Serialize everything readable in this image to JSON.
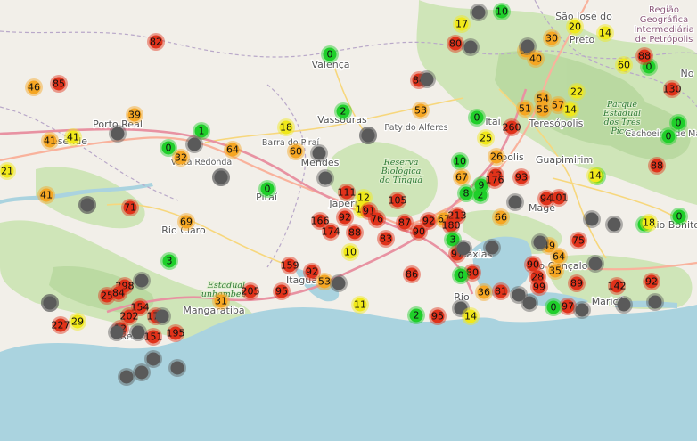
{
  "map": {
    "colors": {
      "land": "#f2efe9",
      "forest": "#cfe5b8",
      "forest_dark": "#b5d79c",
      "water": "#aad3df",
      "road_major": "#e892a2",
      "road_trunk": "#f9b29c",
      "road_minor": "#f7d77d",
      "boundary": "#b9a8c9"
    },
    "marker_colors": {
      "gray": "#5a5a5a",
      "green": "#1fcf2a",
      "yellow": "#f0e81a",
      "orange": "#f5a623",
      "red": "#e0321a"
    },
    "places": [
      {
        "id": "valenca",
        "text": "Valença"
      },
      {
        "id": "porto-real",
        "text": "Porto Real"
      },
      {
        "id": "resende",
        "text": "esende"
      },
      {
        "id": "volta-redonda",
        "text": "Volta Redonda"
      },
      {
        "id": "barra-do-pirai",
        "text": "Barra do Piraí"
      },
      {
        "id": "vassouras",
        "text": "Vassouras"
      },
      {
        "id": "paty-do-alferes",
        "text": "Paty do Alferes"
      },
      {
        "id": "mendes",
        "text": "Mendes"
      },
      {
        "id": "pirai",
        "text": "Piraí"
      },
      {
        "id": "rio-claro",
        "text": "Rio Claro"
      },
      {
        "id": "itaguai",
        "text": "Itaguaí"
      },
      {
        "id": "mangaratiba",
        "text": "Mangaratiba"
      },
      {
        "id": "angra-reis",
        "text": "Reis"
      },
      {
        "id": "japeri",
        "text": "Japeri"
      },
      {
        "id": "petropolis",
        "text": "polis"
      },
      {
        "id": "teresopolis",
        "text": "Teresópolis"
      },
      {
        "id": "guapimirim",
        "text": "Guapimirim"
      },
      {
        "id": "mage",
        "text": "Magé"
      },
      {
        "id": "caxias",
        "text": "Caxias"
      },
      {
        "id": "sao-goncalo",
        "text": "São Gonçalo"
      },
      {
        "id": "marica",
        "text": "Maricá"
      },
      {
        "id": "rio-bonito",
        "text": "Rio Bonito"
      },
      {
        "id": "cachoeiras-macacu",
        "text": "Cachoeiras de Macacu"
      },
      {
        "id": "sao-jose",
        "text": "São José do"
      },
      {
        "id": "preto",
        "text": "Preto"
      },
      {
        "id": "rio",
        "text": "Rio"
      },
      {
        "id": "itaipava",
        "text": "Itai"
      },
      {
        "id": "nova",
        "text": "No"
      }
    ],
    "regions": [
      {
        "id": "regiao",
        "lines": [
          "Região",
          "Geográfica",
          "Intermediária",
          "de Petrópolis"
        ]
      }
    ],
    "parks": [
      {
        "id": "reserva-tingua",
        "lines": [
          "Reserva",
          "Biológica",
          "do Tinguá"
        ]
      },
      {
        "id": "parque-tres-picos",
        "lines": [
          "Parque",
          "Estadual",
          "dos Três",
          "Picos"
        ]
      },
      {
        "id": "parque-cunhambebe",
        "lines": [
          "Estadual",
          "unhambebe"
        ]
      }
    ],
    "markers": [
      {
        "v": "82",
        "c": "red"
      },
      {
        "v": "0",
        "c": "green"
      },
      {
        "v": "46",
        "c": "orange"
      },
      {
        "v": "85",
        "c": "red"
      },
      {
        "v": "39",
        "c": "orange"
      },
      {
        "v": "41",
        "c": "orange"
      },
      {
        "v": "41",
        "c": "yellow"
      },
      {
        "v": "",
        "c": "gray"
      },
      {
        "v": "1",
        "c": "green"
      },
      {
        "v": "0",
        "c": "green"
      },
      {
        "v": "",
        "c": "gray"
      },
      {
        "v": "32",
        "c": "orange"
      },
      {
        "v": "64",
        "c": "orange"
      },
      {
        "v": "2",
        "c": "green"
      },
      {
        "v": "18",
        "c": "yellow"
      },
      {
        "v": "53",
        "c": "orange"
      },
      {
        "v": "",
        "c": "gray"
      },
      {
        "v": "",
        "c": "gray"
      },
      {
        "v": "60",
        "c": "orange"
      },
      {
        "v": "",
        "c": "gray"
      },
      {
        "v": "",
        "c": "gray"
      },
      {
        "v": "0",
        "c": "green"
      },
      {
        "v": "21",
        "c": "yellow"
      },
      {
        "v": "41",
        "c": "orange"
      },
      {
        "v": "",
        "c": "gray"
      },
      {
        "v": "71",
        "c": "red"
      },
      {
        "v": "69",
        "c": "orange"
      },
      {
        "v": "3",
        "c": "green"
      },
      {
        "v": "",
        "c": "gray"
      },
      {
        "v": "31",
        "c": "orange"
      },
      {
        "v": "205",
        "c": "red"
      },
      {
        "v": "95",
        "c": "red"
      },
      {
        "v": "",
        "c": "gray"
      },
      {
        "v": "298",
        "c": "red"
      },
      {
        "v": "25",
        "c": "red"
      },
      {
        "v": "84",
        "c": "red"
      },
      {
        "v": "29",
        "c": "yellow"
      },
      {
        "v": "227",
        "c": "red"
      },
      {
        "v": "154",
        "c": "red"
      },
      {
        "v": "202",
        "c": "red"
      },
      {
        "v": "178",
        "c": "red"
      },
      {
        "v": "",
        "c": "gray"
      },
      {
        "v": "12",
        "c": "red"
      },
      {
        "v": "151",
        "c": "red"
      },
      {
        "v": "195",
        "c": "red"
      },
      {
        "v": "",
        "c": "gray"
      },
      {
        "v": "",
        "c": "gray"
      },
      {
        "v": "",
        "c": "gray"
      },
      {
        "v": "",
        "c": "gray"
      },
      {
        "v": "",
        "c": "gray"
      },
      {
        "v": "",
        "c": "gray"
      },
      {
        "v": "159",
        "c": "red"
      },
      {
        "v": "92",
        "c": "red"
      },
      {
        "v": "53",
        "c": "orange"
      },
      {
        "v": "",
        "c": "gray"
      },
      {
        "v": "11",
        "c": "yellow"
      },
      {
        "v": "10",
        "c": "yellow"
      },
      {
        "v": "166",
        "c": "red"
      },
      {
        "v": "174",
        "c": "red"
      },
      {
        "v": "111",
        "c": "red"
      },
      {
        "v": "92",
        "c": "red"
      },
      {
        "v": "12",
        "c": "yellow"
      },
      {
        "v": "10",
        "c": "yellow"
      },
      {
        "v": "88",
        "c": "red"
      },
      {
        "v": "91",
        "c": "red"
      },
      {
        "v": "105",
        "c": "red"
      },
      {
        "v": "76",
        "c": "red"
      },
      {
        "v": "83",
        "c": "red"
      },
      {
        "v": "87",
        "c": "red"
      },
      {
        "v": "92",
        "c": "red"
      },
      {
        "v": "67",
        "c": "orange"
      },
      {
        "v": "213",
        "c": "red"
      },
      {
        "v": "180",
        "c": "red"
      },
      {
        "v": "90",
        "c": "red"
      },
      {
        "v": "3",
        "c": "green"
      },
      {
        "v": "97",
        "c": "red"
      },
      {
        "v": "86",
        "c": "red"
      },
      {
        "v": "80",
        "c": "red"
      },
      {
        "v": "0",
        "c": "green"
      },
      {
        "v": "36",
        "c": "orange"
      },
      {
        "v": "81",
        "c": "red"
      },
      {
        "v": "95",
        "c": "red"
      },
      {
        "v": "2",
        "c": "green"
      },
      {
        "v": "",
        "c": "gray"
      },
      {
        "v": "14",
        "c": "yellow"
      },
      {
        "v": "17",
        "c": "yellow"
      },
      {
        "v": "",
        "c": "gray"
      },
      {
        "v": "10",
        "c": "green"
      },
      {
        "v": "80",
        "c": "red"
      },
      {
        "v": "",
        "c": "gray"
      },
      {
        "v": "84",
        "c": "red"
      },
      {
        "v": "0",
        "c": "green"
      },
      {
        "v": "25",
        "c": "yellow"
      },
      {
        "v": "10",
        "c": "green"
      },
      {
        "v": "67",
        "c": "orange"
      },
      {
        "v": "8",
        "c": "green"
      },
      {
        "v": "2",
        "c": "green"
      },
      {
        "v": "9",
        "c": "green"
      },
      {
        "v": "13",
        "c": "red"
      },
      {
        "v": "176",
        "c": "red"
      },
      {
        "v": "93",
        "c": "red"
      },
      {
        "v": "94",
        "c": "red"
      },
      {
        "v": "101",
        "c": "red"
      },
      {
        "v": "",
        "c": "gray"
      },
      {
        "v": "66",
        "c": "orange"
      },
      {
        "v": "260",
        "c": "red"
      },
      {
        "v": "26",
        "c": "orange"
      },
      {
        "v": "51",
        "c": "orange"
      },
      {
        "v": "54",
        "c": "orange"
      },
      {
        "v": "55",
        "c": "orange"
      },
      {
        "v": "57",
        "c": "orange"
      },
      {
        "v": "14",
        "c": "yellow"
      },
      {
        "v": "0",
        "c": "green"
      },
      {
        "v": "22",
        "c": "yellow"
      },
      {
        "v": "20",
        "c": "yellow"
      },
      {
        "v": "14",
        "c": "yellow"
      },
      {
        "v": "30",
        "c": "orange"
      },
      {
        "v": "34",
        "c": "orange"
      },
      {
        "v": "",
        "c": "gray"
      },
      {
        "v": "40",
        "c": "orange"
      },
      {
        "v": "60",
        "c": "yellow"
      },
      {
        "v": "0",
        "c": "green"
      },
      {
        "v": "88",
        "c": "red"
      },
      {
        "v": "0",
        "c": "green"
      },
      {
        "v": "14",
        "c": "yellow"
      },
      {
        "v": "88",
        "c": "red"
      },
      {
        "v": "0",
        "c": "green"
      },
      {
        "v": "130",
        "c": "red"
      },
      {
        "v": "0",
        "c": "green"
      },
      {
        "v": "1",
        "c": "green"
      },
      {
        "v": "18",
        "c": "yellow"
      },
      {
        "v": "75",
        "c": "red"
      },
      {
        "v": "49",
        "c": "orange"
      },
      {
        "v": "64",
        "c": "orange"
      },
      {
        "v": "90",
        "c": "red"
      },
      {
        "v": "35",
        "c": "orange"
      },
      {
        "v": "28",
        "c": "red"
      },
      {
        "v": "99",
        "c": "red"
      },
      {
        "v": "89",
        "c": "red"
      },
      {
        "v": "142",
        "c": "red"
      },
      {
        "v": "92",
        "c": "red"
      },
      {
        "v": "97",
        "c": "red"
      },
      {
        "v": "0",
        "c": "green"
      },
      {
        "v": "",
        "c": "gray"
      },
      {
        "v": "",
        "c": "gray"
      },
      {
        "v": "",
        "c": "gray"
      },
      {
        "v": "",
        "c": "gray"
      },
      {
        "v": "",
        "c": "gray"
      },
      {
        "v": "",
        "c": "gray"
      },
      {
        "v": "",
        "c": "gray"
      },
      {
        "v": "",
        "c": "gray"
      },
      {
        "v": "",
        "c": "gray"
      },
      {
        "v": "",
        "c": "gray"
      },
      {
        "v": "",
        "c": "gray"
      },
      {
        "v": "",
        "c": "gray"
      },
      {
        "v": "",
        "c": "gray"
      },
      {
        "v": "",
        "c": "gray"
      },
      {
        "v": "",
        "c": "gray"
      },
      {
        "v": "",
        "c": "gray"
      }
    ]
  }
}
